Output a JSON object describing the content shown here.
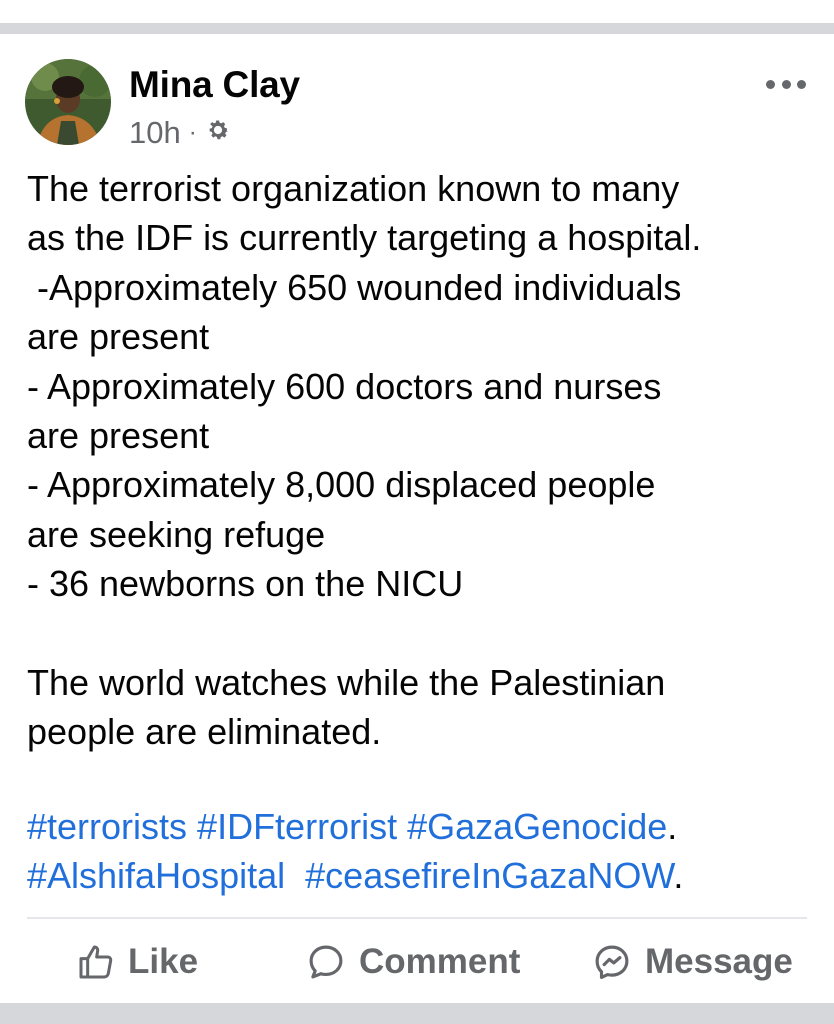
{
  "post": {
    "author": "Mina Clay",
    "time": "10h",
    "separator": "·",
    "privacy_icon": "gear-icon",
    "more_icon": "more-options-icon",
    "body_lines": [
      "The terrorist organization known to many",
      "as the IDF is currently targeting a hospital.",
      " -Approximately 650 wounded individuals",
      "are present",
      "- Approximately 600 doctors and nurses",
      "are present",
      "- Approximately 8,000 displaced people",
      "are seeking refuge",
      "- 36 newborns on the NICU",
      "",
      "The world watches while the Palestinian",
      "people are eliminated."
    ],
    "hashtags_line1": [
      "#terrorists",
      "#IDFterrorist",
      "#GazaGenocide"
    ],
    "hashtags_line1_suffix": ".",
    "hashtags_line2": [
      "#AlshifaHospital",
      "#ceasefireInGazaNOW"
    ],
    "hashtags_line2_suffix": "."
  },
  "actions": {
    "like": "Like",
    "comment": "Comment",
    "message": "Message"
  },
  "colors": {
    "link": "#216fdb",
    "secondary_text": "#65676b",
    "divider": "#e4e6eb",
    "band": "#d6d7db"
  }
}
